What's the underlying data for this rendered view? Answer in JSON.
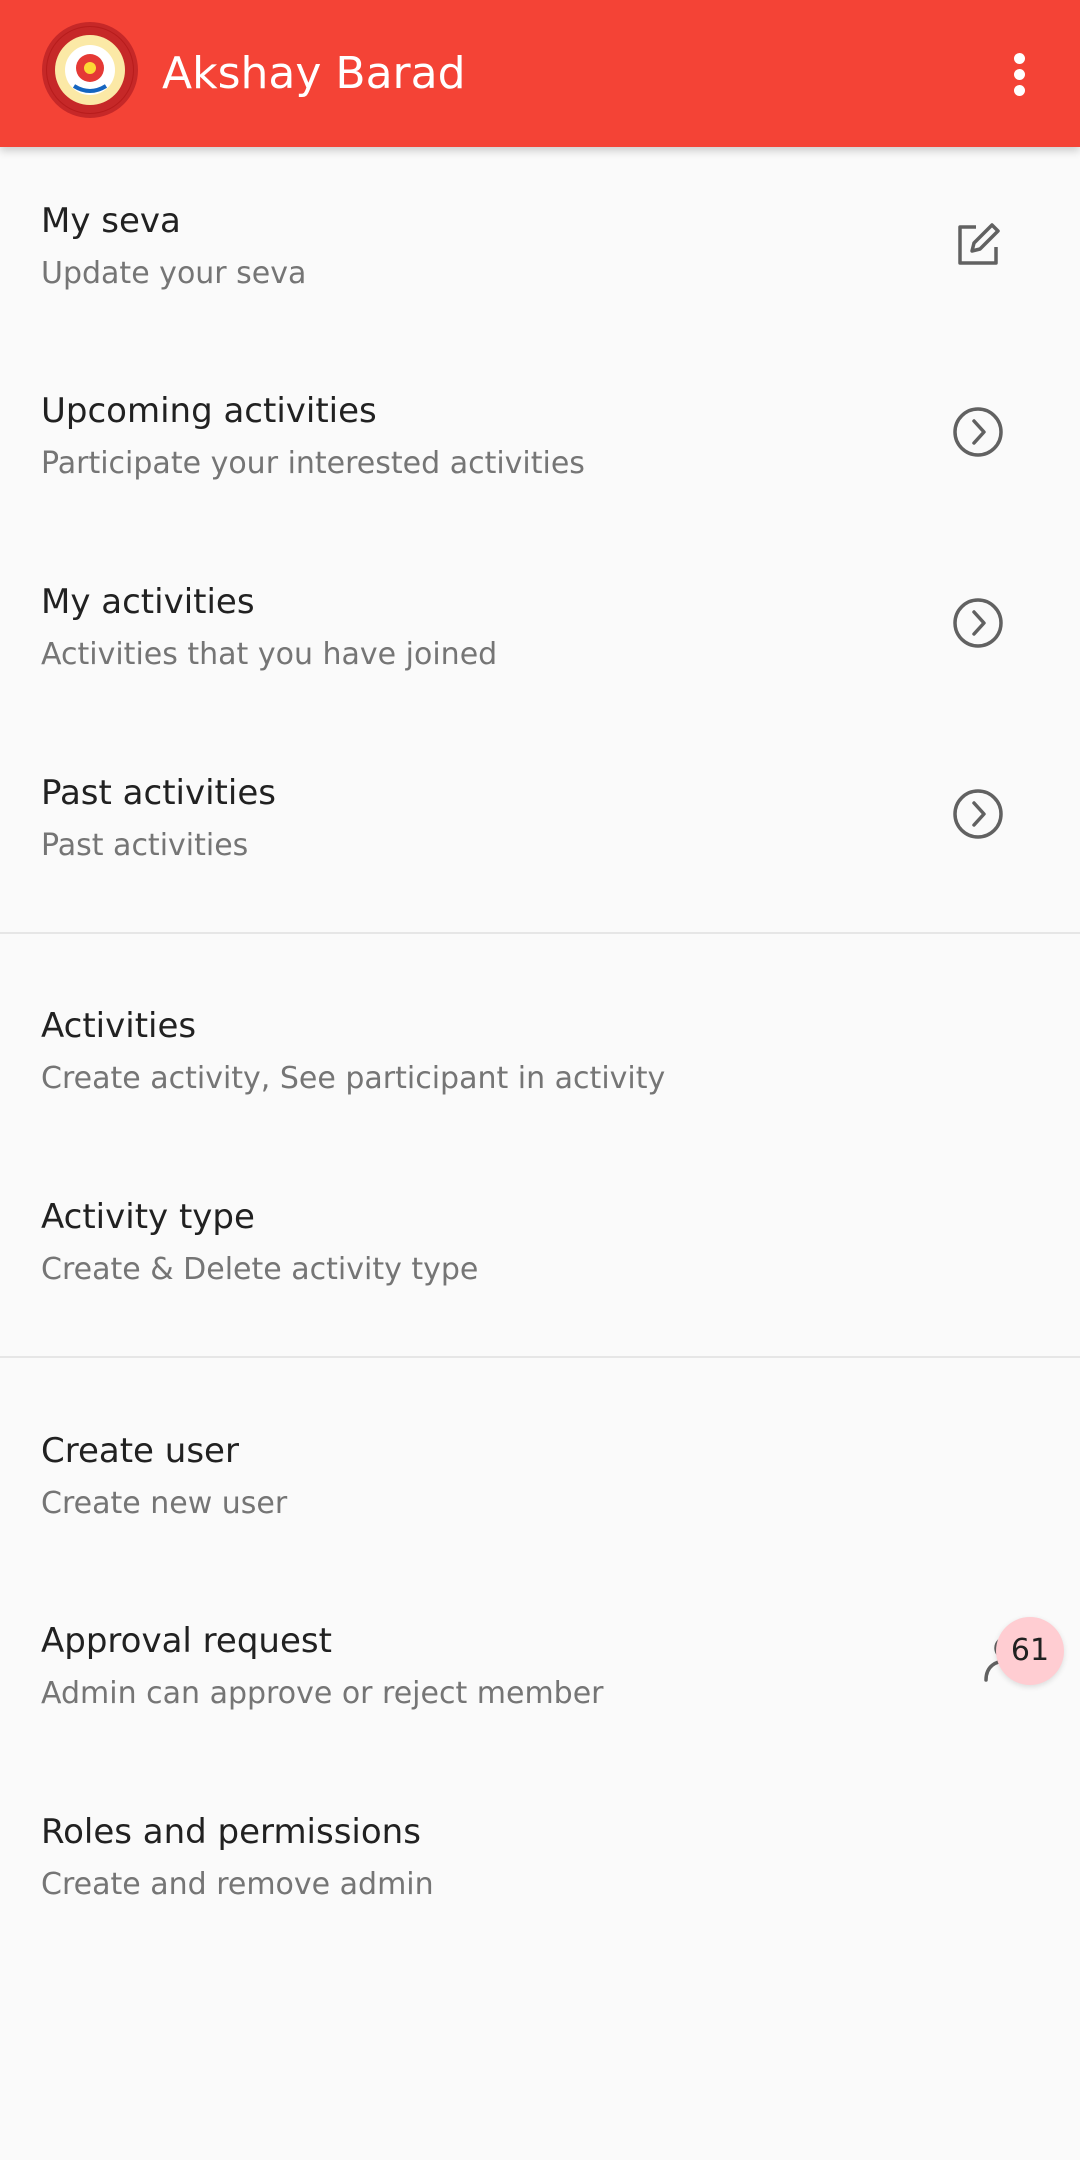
{
  "header": {
    "title": "Akshay Barad",
    "background_color": "#f44336",
    "logo_icon": "organization-logo",
    "menu_icon": "more-vert-icon"
  },
  "menu": {
    "items": [
      {
        "title": "My seva",
        "subtitle": "Update your seva",
        "icon": "edit-icon"
      },
      {
        "title": "Upcoming activities",
        "subtitle": "Participate your interested activities",
        "icon": "chevron-right-circle-icon"
      },
      {
        "title": "My activities",
        "subtitle": "Activities that you have joined",
        "icon": "chevron-right-circle-icon"
      },
      {
        "title": "Past activities",
        "subtitle": "Past activities",
        "icon": "chevron-right-circle-icon"
      },
      {
        "title": "Activities",
        "subtitle": "Create activity, See participant in activity"
      },
      {
        "title": "Activity type",
        "subtitle": "Create & Delete activity type"
      },
      {
        "title": "Create user",
        "subtitle": "Create new user"
      },
      {
        "title": "Approval request",
        "subtitle": "Admin can approve or reject member",
        "icon": "person-icon",
        "badge": "61"
      },
      {
        "title": "Roles and permissions",
        "subtitle": "Create and remove admin"
      }
    ]
  }
}
